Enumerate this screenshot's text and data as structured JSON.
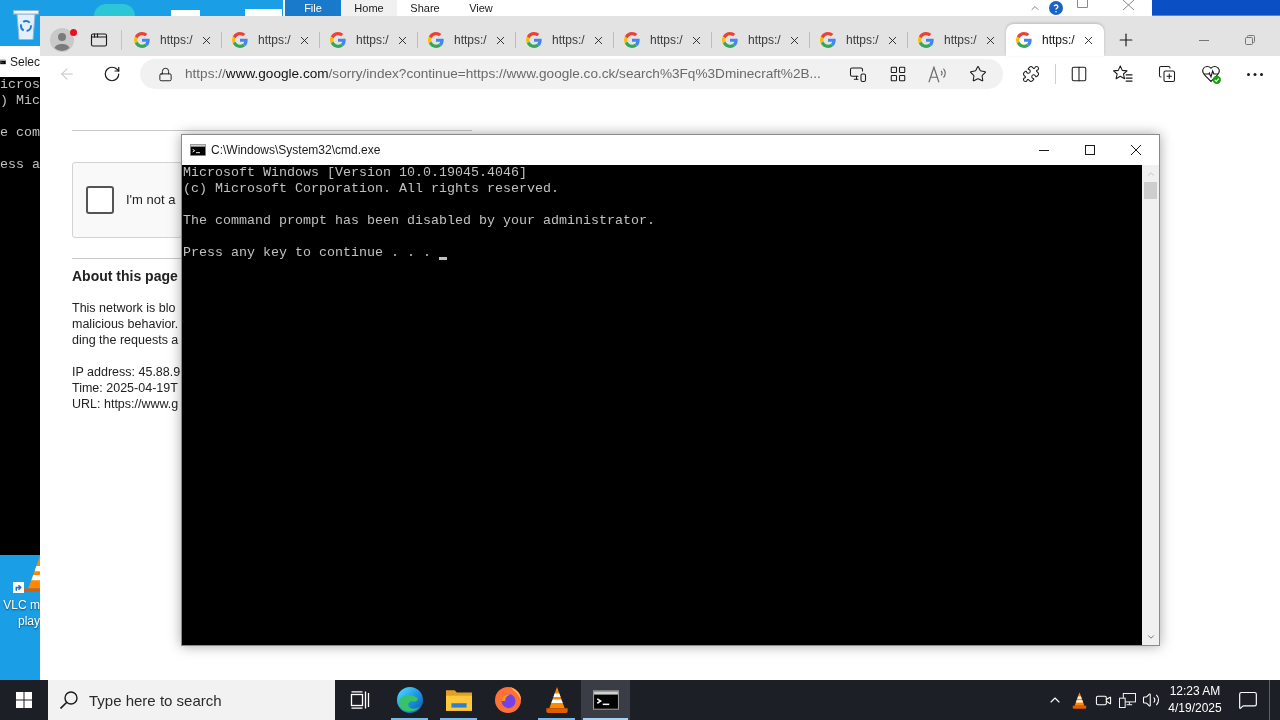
{
  "desktop": {
    "vlc_label": [
      "VLC m",
      "play"
    ]
  },
  "explorer_ribbon": {
    "tabs": [
      {
        "label": "File",
        "kind": "menu",
        "selected": false
      },
      {
        "label": "Home",
        "kind": "tab",
        "selected": true
      },
      {
        "label": "Share",
        "kind": "tab",
        "selected": false
      },
      {
        "label": "View",
        "kind": "tab",
        "selected": false
      }
    ]
  },
  "background_console": {
    "title": "Selec",
    "blocks": [
      [
        "icros",
        ") Mic"
      ],
      [
        "e com"
      ],
      [
        "ess a"
      ]
    ]
  },
  "browser": {
    "profile": {
      "notification": true
    },
    "tabs": [
      {
        "title": "https:/",
        "selected": false
      },
      {
        "title": "https:/",
        "selected": false
      },
      {
        "title": "https:/",
        "selected": false
      },
      {
        "title": "https:/",
        "selected": false
      },
      {
        "title": "https:/",
        "selected": false
      },
      {
        "title": "https:/",
        "selected": false
      },
      {
        "title": "https:/",
        "selected": false
      },
      {
        "title": "https:/",
        "selected": false
      },
      {
        "title": "https:/",
        "selected": false
      },
      {
        "title": "https:/",
        "selected": true
      }
    ],
    "back_button": {
      "disabled": true
    },
    "address": {
      "scheme": "https://",
      "host": "www.google.com",
      "rest": "/sorry/index?continue=https://www.google.co.ck/search%3Fq%3Dminecraft%2B..."
    },
    "page": {
      "captcha": {
        "label": "I'm not a",
        "checked": false
      },
      "heading": "About this page",
      "paragraph": [
        "This network is blo",
        "malicious behavior.",
        "ding the requests a"
      ],
      "details": [
        "IP address: 45.88.9",
        "Time: 2025-04-19T",
        "URL: https://www.g"
      ]
    }
  },
  "console_window": {
    "title": "C:\\Windows\\System32\\cmd.exe",
    "blocks": [
      [
        "Microsoft Windows [Version 10.0.19045.4046]",
        "(c) Microsoft Corporation. All rights reserved."
      ],
      [
        "The command prompt has been disabled by your administrator."
      ],
      [
        "Press any key to continue . . ."
      ]
    ],
    "cursor": true
  },
  "taskbar": {
    "search": {
      "placeholder": "Type here to search"
    },
    "apps": [
      {
        "kind": "edge",
        "running": true,
        "selected": false
      },
      {
        "kind": "explorer",
        "running": true,
        "selected": false
      },
      {
        "kind": "firefox",
        "running": false,
        "selected": false
      },
      {
        "kind": "vlc",
        "running": true,
        "selected": false
      },
      {
        "kind": "terminal",
        "running": true,
        "selected": true
      }
    ],
    "clock": {
      "time": "12:23 AM",
      "date": "4/19/2025"
    }
  }
}
